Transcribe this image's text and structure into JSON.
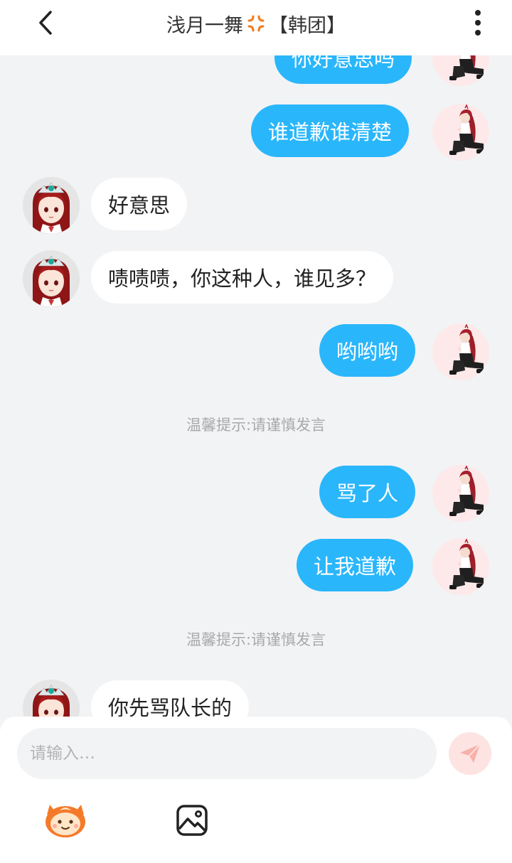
{
  "header": {
    "title": "浅月一舞",
    "title_suffix": "【韩团】",
    "back_icon": "chevron-left-icon",
    "more_icon": "vertical-dots-icon"
  },
  "messages": {
    "m0": "你好意思吗",
    "m1": "谁道歉谁清楚",
    "m2": "好意思",
    "m3": "啧啧啧，你这种人，谁见多？",
    "m4": "哟哟哟",
    "tip1": "温馨提示:请谨慎发言",
    "m5": "骂了人",
    "m6": "让我道歉",
    "tip2": "温馨提示:请谨慎发言",
    "m7": "你先骂队长的"
  },
  "input": {
    "placeholder": "请输入…",
    "value": ""
  },
  "toolbar": {
    "emoji_icon": "sticker-face-icon",
    "image_icon": "image-icon",
    "send_icon": "paper-plane-icon"
  },
  "colors": {
    "mine_bubble": "#2ab6fb",
    "theirs_bubble": "#ffffff",
    "background": "#f2f3f5",
    "send_button_bg": "#fde3e1",
    "send_icon": "#f7b0aa",
    "tip_text": "#a9a9a9"
  }
}
